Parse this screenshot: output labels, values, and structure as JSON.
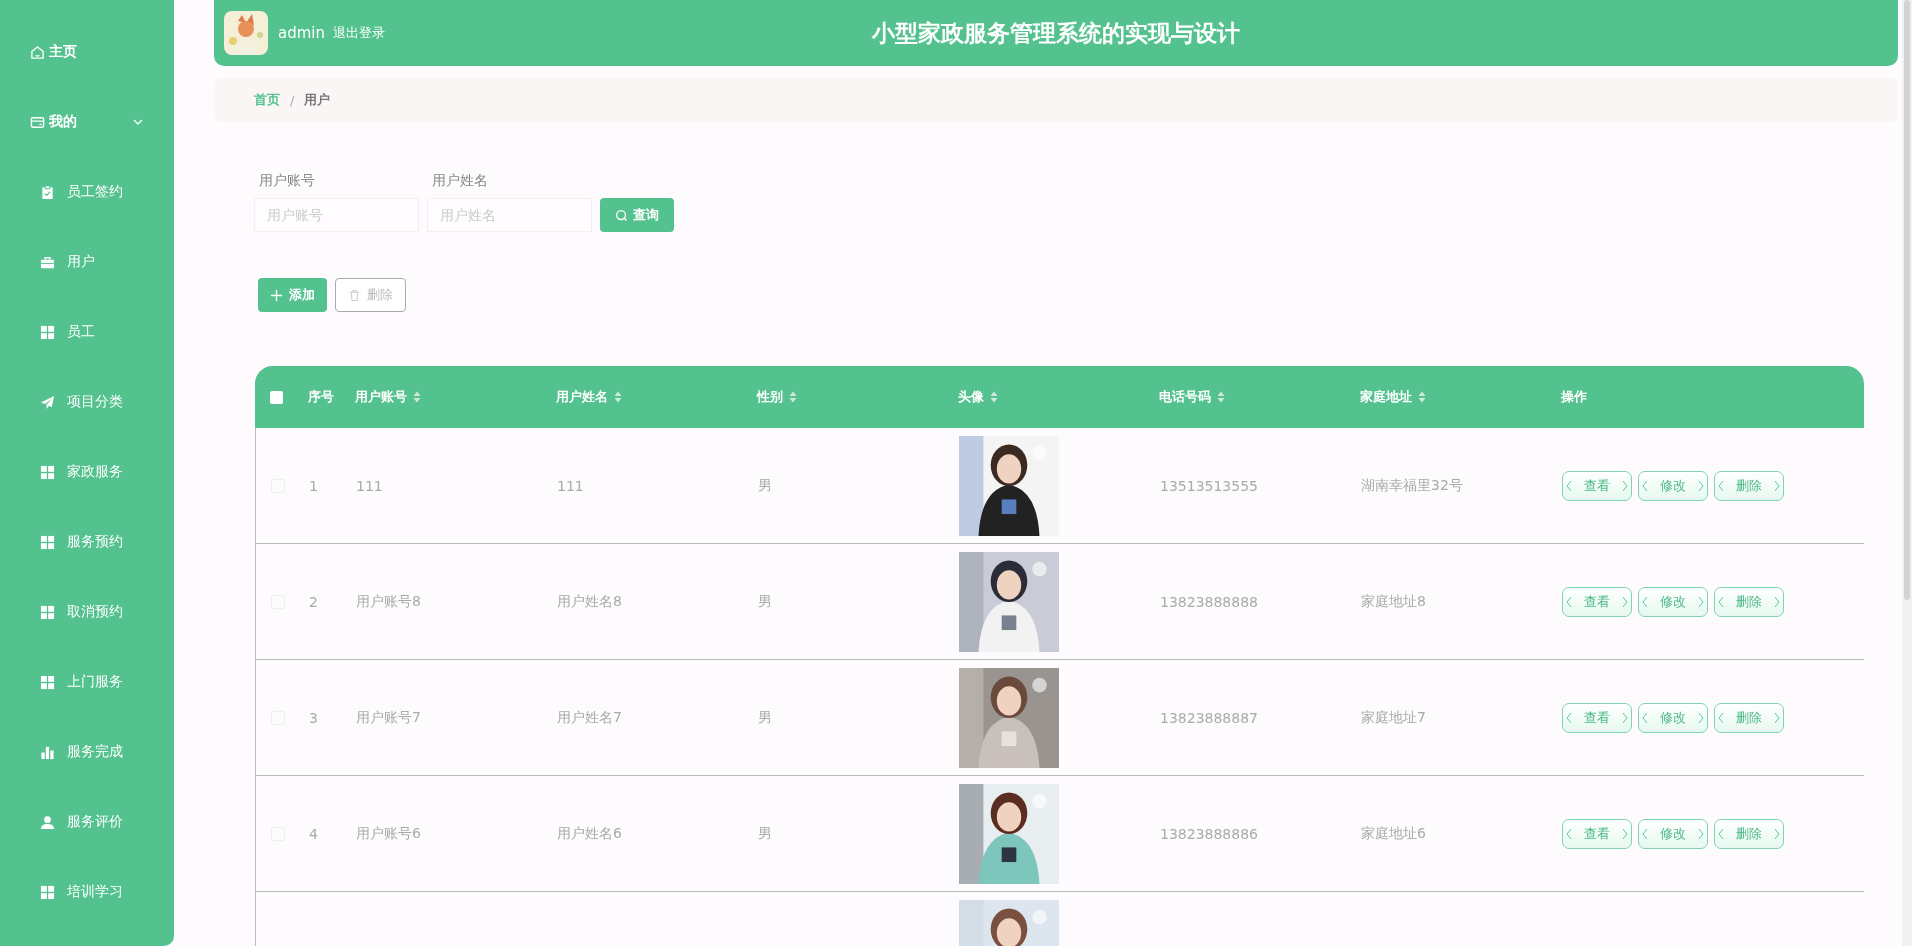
{
  "sidebar": {
    "items": [
      {
        "label": "主页"
      },
      {
        "label": "我的",
        "expanded": true,
        "children": [
          {
            "label": "员工签约"
          },
          {
            "label": "用户"
          },
          {
            "label": "员工"
          },
          {
            "label": "项目分类"
          },
          {
            "label": "家政服务"
          },
          {
            "label": "服务预约"
          },
          {
            "label": "取消预约"
          },
          {
            "label": "上门服务"
          },
          {
            "label": "服务完成"
          },
          {
            "label": "服务评价"
          },
          {
            "label": "培训学习"
          }
        ]
      }
    ]
  },
  "header": {
    "user": "admin",
    "logout": "退出登录",
    "title": "小型家政服务管理系统的实现与设计"
  },
  "breadcrumb": {
    "separator": "/",
    "items": [
      {
        "label": "首页"
      },
      {
        "label": "用户"
      }
    ]
  },
  "search": {
    "fields": [
      {
        "label": "用户账号",
        "placeholder": "用户账号"
      },
      {
        "label": "用户姓名",
        "placeholder": "用户姓名"
      }
    ],
    "button": "查询"
  },
  "toolbar": {
    "add": "添加",
    "delete": "删除"
  },
  "table": {
    "columns": [
      "序号",
      "用户账号",
      "用户姓名",
      "性别",
      "头像",
      "电话号码",
      "家庭地址",
      "操作"
    ],
    "all_checked": false,
    "rows": [
      {
        "kind": "full",
        "checked": false,
        "index": "1",
        "account": "111",
        "name": "111",
        "gender": "男",
        "phone": "13513513555",
        "address": "湖南幸福里32号",
        "actions": [
          "查看",
          "修改",
          "删除"
        ]
      },
      {
        "kind": "full",
        "checked": false,
        "index": "2",
        "account": "用户账号8",
        "name": "用户姓名8",
        "gender": "男",
        "phone": "13823888888",
        "address": "家庭地址8",
        "actions": [
          "查看",
          "修改",
          "删除"
        ]
      },
      {
        "kind": "full",
        "checked": false,
        "index": "3",
        "account": "用户账号7",
        "name": "用户姓名7",
        "gender": "男",
        "phone": "13823888887",
        "address": "家庭地址7",
        "actions": [
          "查看",
          "修改",
          "删除"
        ]
      },
      {
        "kind": "full",
        "checked": false,
        "index": "4",
        "account": "用户账号6",
        "name": "用户姓名6",
        "gender": "男",
        "phone": "13823888886",
        "address": "家庭地址6",
        "actions": [
          "查看",
          "修改",
          "删除"
        ]
      },
      {
        "kind": "partial"
      }
    ]
  }
}
